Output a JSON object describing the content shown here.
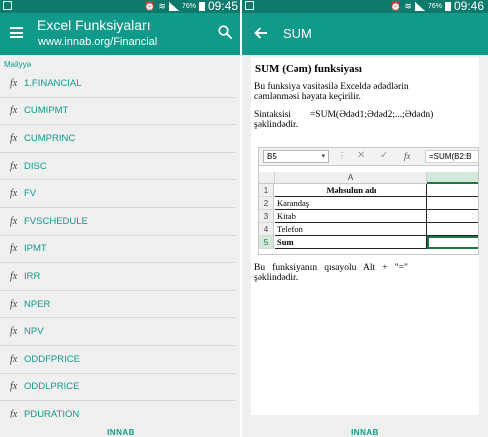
{
  "left": {
    "status": {
      "time": "09:45",
      "battery": "76%"
    },
    "header": {
      "title": "Excel Funksiyaları",
      "subtitle": "www.innab.org/Financial"
    },
    "section_label": "Maliyyə",
    "fx_glyph": "fx",
    "functions": [
      "1.FINANCIAL",
      "CUMIPMT",
      "CUMPRINC",
      "DISC",
      "FV",
      "FVSCHEDULE",
      "IPMT",
      "IRR",
      "NPER",
      "NPV",
      "ODDFPRICE",
      "ODDLPRICE",
      "PDURATION"
    ],
    "footer_logo": "INNAB"
  },
  "right": {
    "status": {
      "time": "09:46",
      "battery": "76%"
    },
    "header": {
      "title": "SUM"
    },
    "doc": {
      "title": "SUM (Cəm) funksiyası",
      "para1_line1": "Bu funksiya vasitəsilə Exceldə ədədlərin",
      "para1_line2": "cəmlənməsi həyata keçirilir.",
      "para2_line1": "Sintaksisi        =SUM(Ədəd1;Ədəd2;...;Ədədn)",
      "para2_line2": "şəklindədir.",
      "para3_line1": "Bu   funksiyanın   qısayolu   Alt   +   \"=\"",
      "para3_line2": "şəklindədir."
    },
    "excel": {
      "namebox": "B5",
      "dots": "⋮",
      "cancel": "✕",
      "enter": "✓",
      "fx": "fx",
      "formula": "=SUM(B2:B",
      "col_a": "A",
      "rows": [
        {
          "num": "1",
          "a": "Məhsulun adı"
        },
        {
          "num": "2",
          "a": "Karandaş"
        },
        {
          "num": "3",
          "a": "Kitab"
        },
        {
          "num": "4",
          "a": "Telefon"
        },
        {
          "num": "5",
          "a": "Sum"
        }
      ]
    },
    "footer_logo": "INNAB"
  },
  "colors": {
    "appbar": "#11998a",
    "statusbar": "#0e7a6c",
    "accent_text": "#11998a",
    "excel_green": "#217346"
  }
}
